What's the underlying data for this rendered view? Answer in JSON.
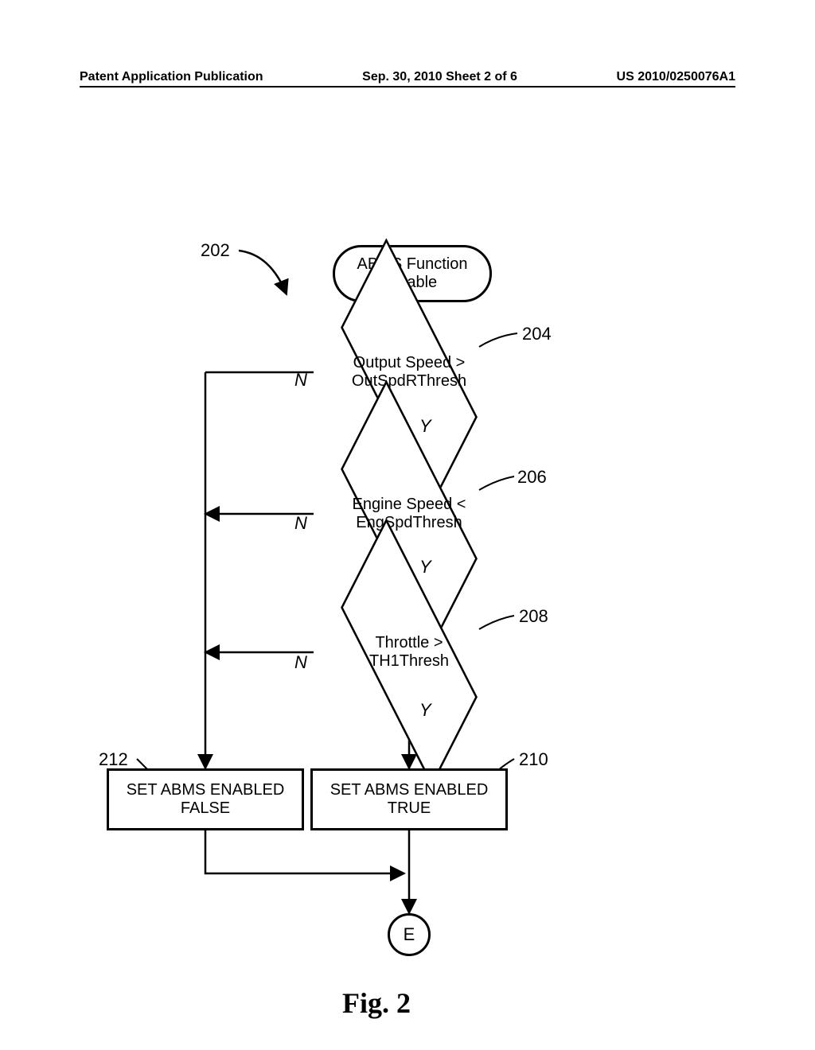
{
  "header": {
    "left": "Patent Application Publication",
    "center": "Sep. 30, 2010  Sheet 2 of 6",
    "right": "US 2010/0250076A1"
  },
  "refs": {
    "r202": "202",
    "r204": "204",
    "r206": "206",
    "r208": "208",
    "r210": "210",
    "r212": "212"
  },
  "labels": {
    "N": "N",
    "Y": "Y",
    "E": "E"
  },
  "nodes": {
    "start_l1": "ABMS Function",
    "start_l2": "Enable",
    "d1_l1": "Output Speed >",
    "d1_l2": "OutSpdRThresh",
    "d2_l1": "Engine Speed <",
    "d2_l2": "EngSpdThresh",
    "d3_l1": "Throttle >",
    "d3_l2": "TH1Thresh",
    "true_l1": "SET ABMS ENABLED",
    "true_l2": "TRUE",
    "false_l1": "SET ABMS ENABLED",
    "false_l2": "FALSE"
  },
  "figure_title": "Fig. 2",
  "chart_data": {
    "type": "flowchart",
    "title": "ABMS Function Enable",
    "nodes": [
      {
        "id": "start",
        "ref": "202",
        "type": "terminator",
        "text": "ABMS Function Enable"
      },
      {
        "id": "d1",
        "ref": "204",
        "type": "decision",
        "text": "Output Speed > OutSpdRThresh"
      },
      {
        "id": "d2",
        "ref": "206",
        "type": "decision",
        "text": "Engine Speed < EngSpdThresh"
      },
      {
        "id": "d3",
        "ref": "208",
        "type": "decision",
        "text": "Throttle > TH1Thresh"
      },
      {
        "id": "true",
        "ref": "210",
        "type": "process",
        "text": "SET ABMS ENABLED TRUE"
      },
      {
        "id": "false",
        "ref": "212",
        "type": "process",
        "text": "SET ABMS ENABLED FALSE"
      },
      {
        "id": "end",
        "ref": null,
        "type": "connector",
        "text": "E"
      }
    ],
    "edges": [
      {
        "from": "start",
        "to": "d1",
        "label": null
      },
      {
        "from": "d1",
        "to": "d2",
        "label": "Y"
      },
      {
        "from": "d1",
        "to": "false",
        "label": "N"
      },
      {
        "from": "d2",
        "to": "d3",
        "label": "Y"
      },
      {
        "from": "d2",
        "to": "false",
        "label": "N"
      },
      {
        "from": "d3",
        "to": "true",
        "label": "Y"
      },
      {
        "from": "d3",
        "to": "false",
        "label": "N"
      },
      {
        "from": "true",
        "to": "end",
        "label": null
      },
      {
        "from": "false",
        "to": "end",
        "label": null
      }
    ]
  }
}
